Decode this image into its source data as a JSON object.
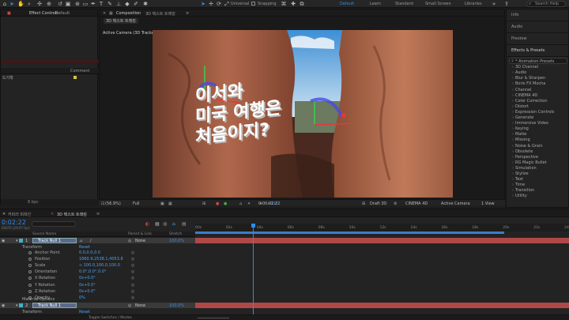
{
  "toolbar": {
    "snapping_label": "Snapping",
    "universal_label": "Universal",
    "workspaces": [
      "Default",
      "Learn",
      "Standard",
      "Small Screen",
      "Libraries"
    ],
    "help_placeholder": "Search Help"
  },
  "effect_controls": {
    "tab_label": "Effect Controls",
    "tab_target": "Default"
  },
  "project": {
    "comment_header": "Comment",
    "item_label": "드기착",
    "footer_label": "8 bpc"
  },
  "composition": {
    "tab_label": "Composition",
    "tab_name": "3D 텍스트 트래킹",
    "subtab": "3D 텍스트 트래킹",
    "camera_label": "Active Camera (3D Tracker Camera 2)",
    "overlay_line1": "이서와",
    "overlay_line2": "미국 여행은",
    "overlay_line3": "처음이지?"
  },
  "viewer_bar": {
    "zoom": "(56.9%)",
    "resolution": "Full",
    "exposure": "+0.0",
    "timecode": "0:00:02:22",
    "renderer": "Draft 3D",
    "engine": "CINEMA 4D",
    "camera": "Active Camera",
    "view": "1 View"
  },
  "right_panel": {
    "sections": [
      "Info",
      "Audio",
      "Preview",
      "Effects & Presets"
    ],
    "search_placeholder": "",
    "effects": [
      "* Animation Presets",
      "3D Channel",
      "Audio",
      "Blur & Sharpen",
      "Boris FX Mocha",
      "Channel",
      "CINEMA 4D",
      "Color Correction",
      "Distort",
      "Expression Controls",
      "Generate",
      "Immersive Video",
      "Keying",
      "Matte",
      "Missing",
      "Noise & Grain",
      "Obsolete",
      "Perspective",
      "RG Magic Bullet",
      "Simulation",
      "Stylize",
      "Text",
      "Time",
      "Transition",
      "Utility"
    ]
  },
  "timeline": {
    "tabs": [
      "커피러 피레인",
      "3D 텍스트 트래킹"
    ],
    "timecode": "0:02:22",
    "timecode_sub": "00070 (29.97 fps)",
    "columns": {
      "source": "Source Name",
      "parent": "Parent & Link",
      "stretch": "Stretch"
    },
    "ruler": [
      "00s",
      "02s",
      "04s",
      "06s",
      "08s",
      "10s",
      "12s",
      "14s",
      "16s",
      "18s",
      "20s",
      "22s",
      "24s"
    ],
    "layers": [
      {
        "index": "1",
        "name": "Track Null 1",
        "parent": "None",
        "stretch": "100.0%"
      },
      {
        "index": "2",
        "name": "Track Null 1",
        "parent": "None",
        "stretch": "100.0%"
      }
    ],
    "transform_label": "Transform",
    "reset_label": "Reset",
    "properties": [
      {
        "name": "Anchor Point",
        "value": "0.0,0.0,0.0"
      },
      {
        "name": "Position",
        "value": "1860.9,2538.1,4053.8"
      },
      {
        "name": "Scale",
        "value": "∞ 100.0,100.0,100.0"
      },
      {
        "name": "Orientation",
        "value": "0.0°,0.0°,0.0°"
      },
      {
        "name": "X Rotation",
        "value": "0x+0.0°"
      },
      {
        "name": "Y Rotation",
        "value": "0x+0.0°"
      },
      {
        "name": "Z Rotation",
        "value": "0x+0.0°"
      },
      {
        "name": "Opacity",
        "value": "0%"
      }
    ],
    "material_label": "Material Options",
    "transform2_label": "Transform",
    "reset2_label": "Reset",
    "footer_label": "Toggle Switches / Modes",
    "playhead_fraction": 0.154
  },
  "colors": {
    "accent": "#2d8ceb",
    "layer_bar": "#b04848",
    "label_cyan": "#3fb2c6"
  }
}
